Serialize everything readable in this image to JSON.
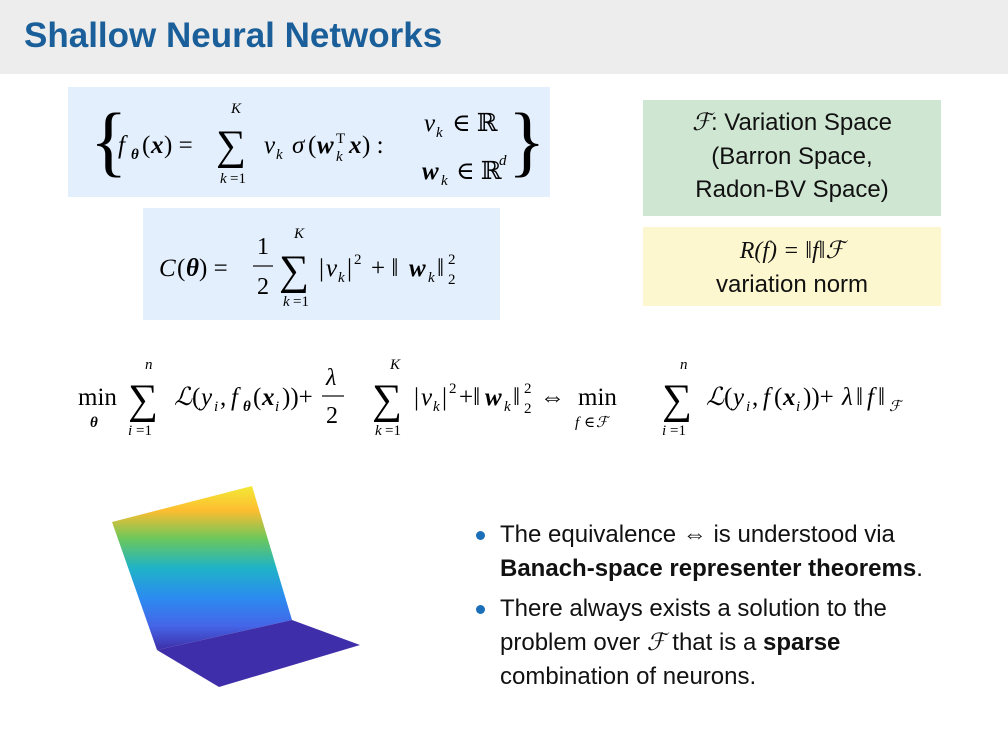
{
  "slide": {
    "title": "Shallow Neural Networks"
  },
  "formulas": {
    "model_class": "{ fθ(x) = Σ_{k=1}^{K} v_k σ(w_kᵀ x) : v_k ∈ ℝ, w_k ∈ ℝ^d }",
    "cost": "C(θ) = 1/2 Σ_{k=1}^{K} |v_k|² + ‖w_k‖₂²",
    "equivalence": "min_θ Σ_{i=1}^{n} L(y_i, fθ(x_i)) + λ/2 Σ_{k=1}^{K} |v_k|² + ‖w_k‖₂² ⇔ min_{f∈F} Σ_{i=1}^{n} L(y_i, f(x_i)) + λ‖f‖_F"
  },
  "variation_space": {
    "symbol": "ℱ",
    "line1": ": Variation Space",
    "line2": "(Barron Space,",
    "line3": "Radon-BV Space)"
  },
  "variation_norm": {
    "formula": "R(f) = ‖f‖ℱ",
    "label": "variation norm"
  },
  "bullets": {
    "b1_pre": "The equivalence ",
    "b1_symbol": "⇔",
    "b1_mid": " is understood via",
    "b1_bold": "Banach-space representer theorems",
    "b1_end": ".",
    "b2_pre": "There always exists a solution to the problem over ",
    "b2_symbol": "ℱ",
    "b2_mid": " that is a ",
    "b2_bold": "sparse",
    "b2_end": " combination of neurons."
  },
  "colors": {
    "title": "#1a5f9a",
    "header_bg": "#ededed",
    "blue_box": "#e3effc",
    "green_box": "#cfe6d2",
    "yellow_box": "#fdf7cf",
    "bullet": "#1a6fb8"
  },
  "figure": {
    "icon": "relu-neuron-surface-plot"
  }
}
